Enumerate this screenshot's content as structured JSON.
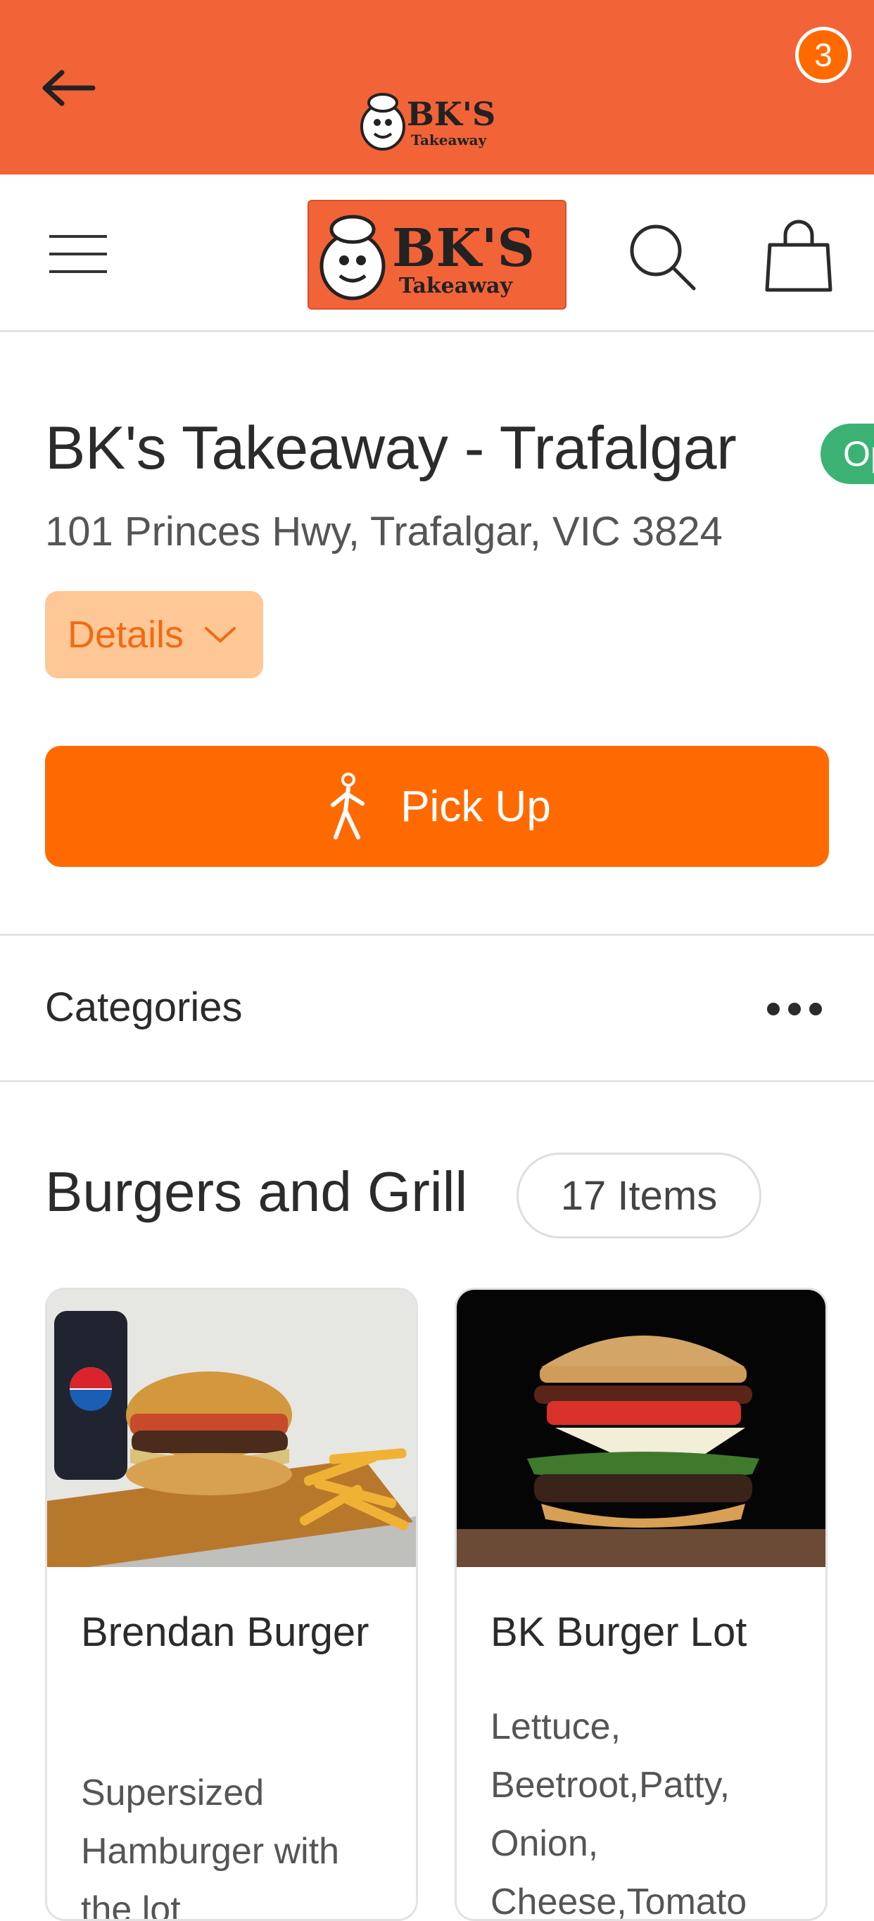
{
  "app_bar": {
    "back_icon": "arrow-left-icon",
    "logo": {
      "word": "BK'S",
      "sub": "Takeaway"
    }
  },
  "header": {
    "menu_icon": "hamburger-menu-icon",
    "logo": {
      "word": "BK'S",
      "sub": "Takeaway"
    },
    "search_icon": "search-icon",
    "cart_icon": "shopping-bag-icon",
    "cart_count": "3"
  },
  "store": {
    "name": "BK's Takeaway - Trafalgar",
    "status": "Op",
    "address": "101 Princes Hwy, Trafalgar, VIC 3824",
    "details_label": "Details"
  },
  "order": {
    "pickup_label": "Pick Up",
    "pickup_icon": "walking-person-icon"
  },
  "categories": {
    "label": "Categories",
    "more_icon": "more-horizontal-icon"
  },
  "section": {
    "title": "Burgers and Grill",
    "count": "17 Items"
  },
  "products": [
    {
      "name": "Brendan Burger",
      "description": "Supersized Hamburger with the lot"
    },
    {
      "name": "BK Burger Lot",
      "description": "Lettuce, Beetroot,Patty, Onion, Cheese,Tomato"
    }
  ],
  "colors": {
    "brand_orange": "#F26338",
    "button_orange": "#FF6A00",
    "details_bg": "#FDC896",
    "open_green": "#3BB273"
  }
}
